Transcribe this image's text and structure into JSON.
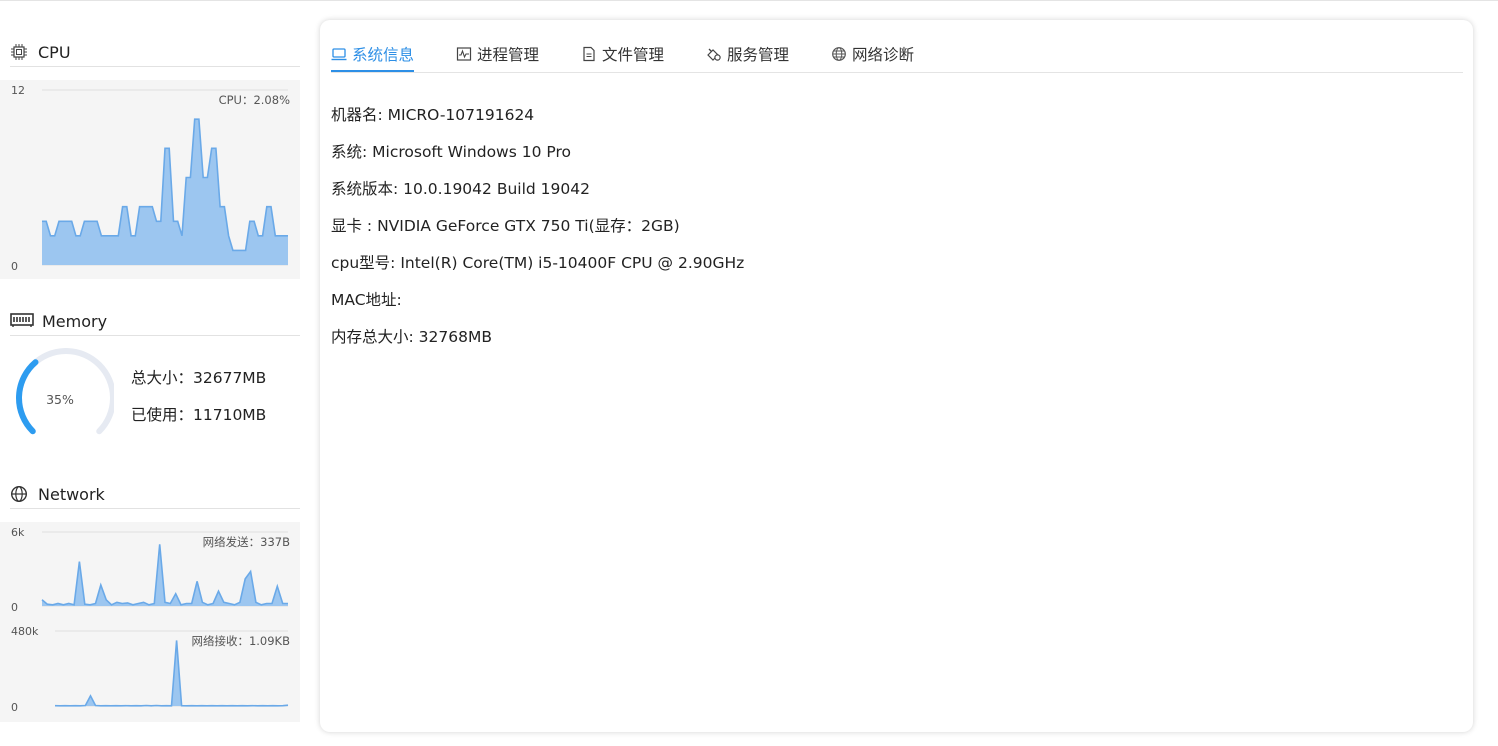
{
  "colors": {
    "accent": "#2d8fe6",
    "chart_fill": "#9cc6f0",
    "chart_line": "#6aa9e8",
    "gauge_track": "#e6eaf2",
    "gauge_fill": "#2d9cf0"
  },
  "sidebar": {
    "cpu": {
      "title": "CPU",
      "icon": "cpu-chip-icon"
    },
    "memory": {
      "title": "Memory",
      "icon": "memory-module-icon",
      "percent_text": "35%",
      "used_fraction": 0.35,
      "total_label": "总大小：32677MB",
      "used_label": "已使用：11710MB"
    },
    "network": {
      "title": "Network",
      "icon": "globe-icon"
    }
  },
  "chart_data": [
    {
      "type": "area",
      "name": "cpu-usage",
      "label": "CPU：2.08%",
      "ylim": [
        0,
        12
      ],
      "yticks": [
        "12",
        "0"
      ],
      "values": [
        3,
        3,
        2,
        2,
        3,
        3,
        3,
        3,
        2,
        2,
        3,
        3,
        3,
        3,
        2,
        2,
        2,
        2,
        2,
        4,
        4,
        2,
        2,
        4,
        4,
        4,
        4,
        3,
        3,
        8,
        8,
        3,
        3,
        2,
        6,
        6,
        10,
        10,
        6,
        6,
        8,
        8,
        4,
        4,
        2,
        1,
        1,
        1,
        1,
        3,
        3,
        2,
        2,
        4,
        4,
        2,
        2,
        2,
        2
      ]
    },
    {
      "type": "area",
      "name": "network-send",
      "label": "网络发送：337B",
      "ylim": [
        0,
        6000
      ],
      "yticks": [
        "6k",
        "0"
      ],
      "values": [
        500,
        150,
        100,
        200,
        100,
        200,
        100,
        3600,
        150,
        100,
        200,
        1700,
        500,
        100,
        300,
        200,
        250,
        100,
        200,
        300,
        100,
        200,
        5000,
        300,
        200,
        1000,
        100,
        200,
        200,
        2000,
        300,
        100,
        200,
        1200,
        300,
        200,
        100,
        300,
        2200,
        2800,
        300,
        100,
        200,
        200,
        1600,
        200,
        200
      ]
    },
    {
      "type": "area",
      "name": "network-receive",
      "label": "网络接收：1.09KB",
      "ylim": [
        0,
        480000
      ],
      "yticks": [
        "480k",
        "0"
      ],
      "values": [
        2000,
        1000,
        2000,
        1000,
        2000,
        1000,
        3000,
        65000,
        3000,
        1000,
        2000,
        1000,
        2000,
        1000,
        2000,
        1000,
        2000,
        1000,
        3000,
        1000,
        3000,
        1000,
        2000,
        1000,
        420000,
        2000,
        1000,
        2000,
        1000,
        2000,
        1000,
        2000,
        1000,
        2000,
        1000,
        2000,
        1000,
        2000,
        1000,
        2000,
        1000,
        2000,
        1000,
        2000,
        1000,
        2000,
        5000
      ]
    }
  ],
  "tabs": [
    {
      "label": "系统信息",
      "icon": "laptop-icon",
      "active": true
    },
    {
      "label": "进程管理",
      "icon": "activity-monitor-icon",
      "active": false
    },
    {
      "label": "文件管理",
      "icon": "file-icon",
      "active": false
    },
    {
      "label": "服务管理",
      "icon": "service-tool-icon",
      "active": false
    },
    {
      "label": "网络诊断",
      "icon": "network-diagnose-icon",
      "active": false
    }
  ],
  "system_info": {
    "hostname": "机器名: MICRO-107191624",
    "os": "系统: Microsoft Windows 10 Pro",
    "os_version": "系统版本: 10.0.19042 Build 19042",
    "gpu": "显卡 : NVIDIA GeForce GTX 750 Ti(显存：2GB)",
    "cpu_model": "cpu型号: Intel(R) Core(TM) i5-10400F CPU @ 2.90GHz",
    "mac": "MAC地址:",
    "memory_total": "内存总大小: 32768MB"
  }
}
